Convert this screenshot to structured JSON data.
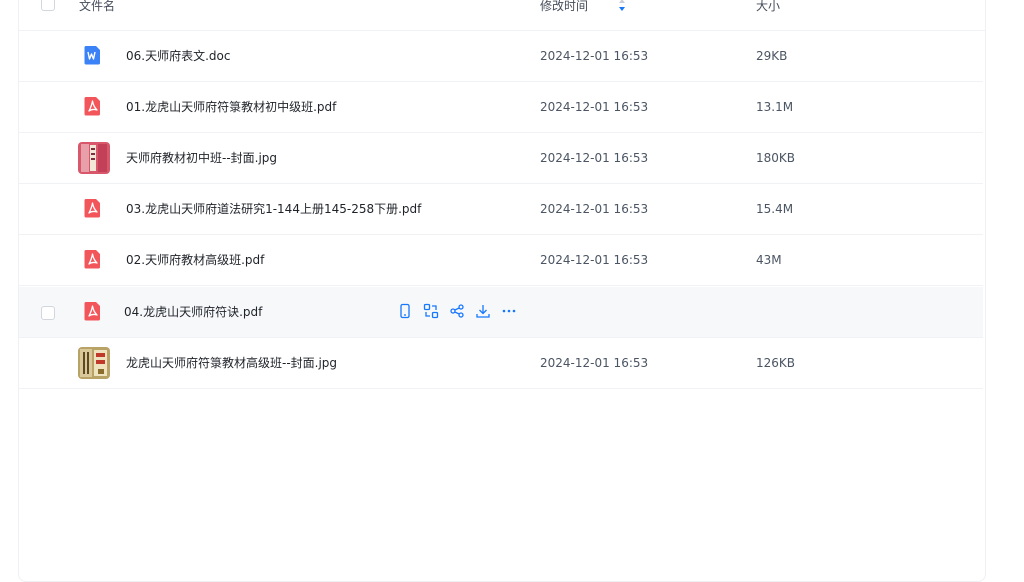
{
  "header": {
    "name_label": "文件名",
    "modified_label": "修改时间",
    "size_label": "大小"
  },
  "files": [
    {
      "name": "06.天师府表文.doc",
      "date": "2024-12-01 16:53",
      "size": "29KB",
      "type": "word-icon"
    },
    {
      "name": "01.龙虎山天师府符箓教材初中级班.pdf",
      "date": "2024-12-01 16:53",
      "size": "13.1M",
      "type": "pdf-icon"
    },
    {
      "name": "天师府教材初中班--封面.jpg",
      "date": "2024-12-01 16:53",
      "size": "180KB",
      "type": "image-thumbnail"
    },
    {
      "name": "03.龙虎山天师府道法研究1-144上册145-258下册.pdf",
      "date": "2024-12-01 16:53",
      "size": "15.4M",
      "type": "pdf-icon"
    },
    {
      "name": "02.天师府教材高级班.pdf",
      "date": "2024-12-01 16:53",
      "size": "43M",
      "type": "pdf-icon"
    },
    {
      "name": "04.龙虎山天师府符诀.pdf",
      "date": "",
      "size": "",
      "type": "pdf-icon",
      "hovered": true
    },
    {
      "name": "龙虎山天师府符箓教材高级班--封面.jpg",
      "date": "2024-12-01 16:53",
      "size": "126KB",
      "type": "image-thumbnail"
    }
  ],
  "row_actions": [
    "phone-icon",
    "convert-icon",
    "share-icon",
    "download-icon",
    "more-icon"
  ],
  "colors": {
    "accent": "#1677ff",
    "pdf": "#f2555a",
    "word": "#3b82f6"
  }
}
